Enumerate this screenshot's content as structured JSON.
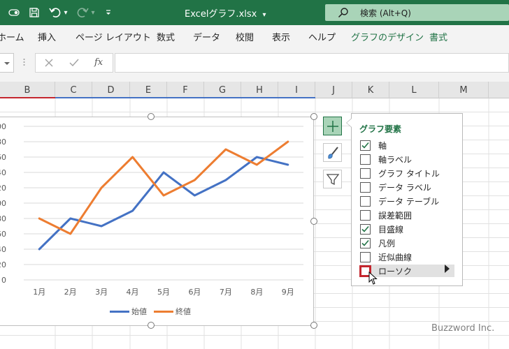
{
  "titlebar": {
    "document_title": "Excelグラフ.xlsx",
    "title_dropdown_glyph": "▾",
    "search_placeholder": "検索 (Alt+Q)",
    "qat_more_glyph": "▾"
  },
  "ribbon": {
    "tabs": [
      "ホーム",
      "挿入",
      "ページ レイアウト",
      "数式",
      "データ",
      "校閲",
      "表示",
      "ヘルプ",
      "グラフのデザイン",
      "書式"
    ]
  },
  "formula_bar": {
    "fx_label": "fx",
    "value": ""
  },
  "columns": [
    "B",
    "C",
    "D",
    "E",
    "F",
    "G",
    "H",
    "I",
    "J",
    "K",
    "L",
    "M"
  ],
  "chart_data": {
    "type": "line",
    "categories": [
      "1月",
      "2月",
      "3月",
      "4月",
      "5月",
      "6月",
      "7月",
      "8月",
      "9月"
    ],
    "series": [
      {
        "name": "始値",
        "color": "#4472c4",
        "values": [
          40,
          80,
          70,
          90,
          140,
          110,
          130,
          160,
          150
        ]
      },
      {
        "name": "終値",
        "color": "#ed7d31",
        "values": [
          80,
          60,
          120,
          160,
          110,
          130,
          170,
          150,
          180
        ]
      }
    ],
    "yticks": [
      "00",
      "80",
      "60",
      "40",
      "20",
      "00",
      "80",
      "60",
      "40",
      "20",
      "0"
    ],
    "ylim": [
      0,
      200
    ],
    "grid": true,
    "legend": "bottom"
  },
  "chart_elements_panel": {
    "title": "グラフ要素",
    "options": [
      {
        "label": "軸",
        "checked": true
      },
      {
        "label": "軸ラベル",
        "checked": false
      },
      {
        "label": "グラフ タイトル",
        "checked": false
      },
      {
        "label": "データ ラベル",
        "checked": false
      },
      {
        "label": "データ テーブル",
        "checked": false
      },
      {
        "label": "誤差範囲",
        "checked": false
      },
      {
        "label": "目盛線",
        "checked": true
      },
      {
        "label": "凡例",
        "checked": true
      },
      {
        "label": "近似曲線",
        "checked": false
      },
      {
        "label": "ローソク",
        "checked": false
      }
    ]
  },
  "side_buttons": [
    "chart-elements-icon",
    "chart-styles-icon",
    "chart-filters-icon"
  ],
  "watermark": "Buzzword Inc."
}
